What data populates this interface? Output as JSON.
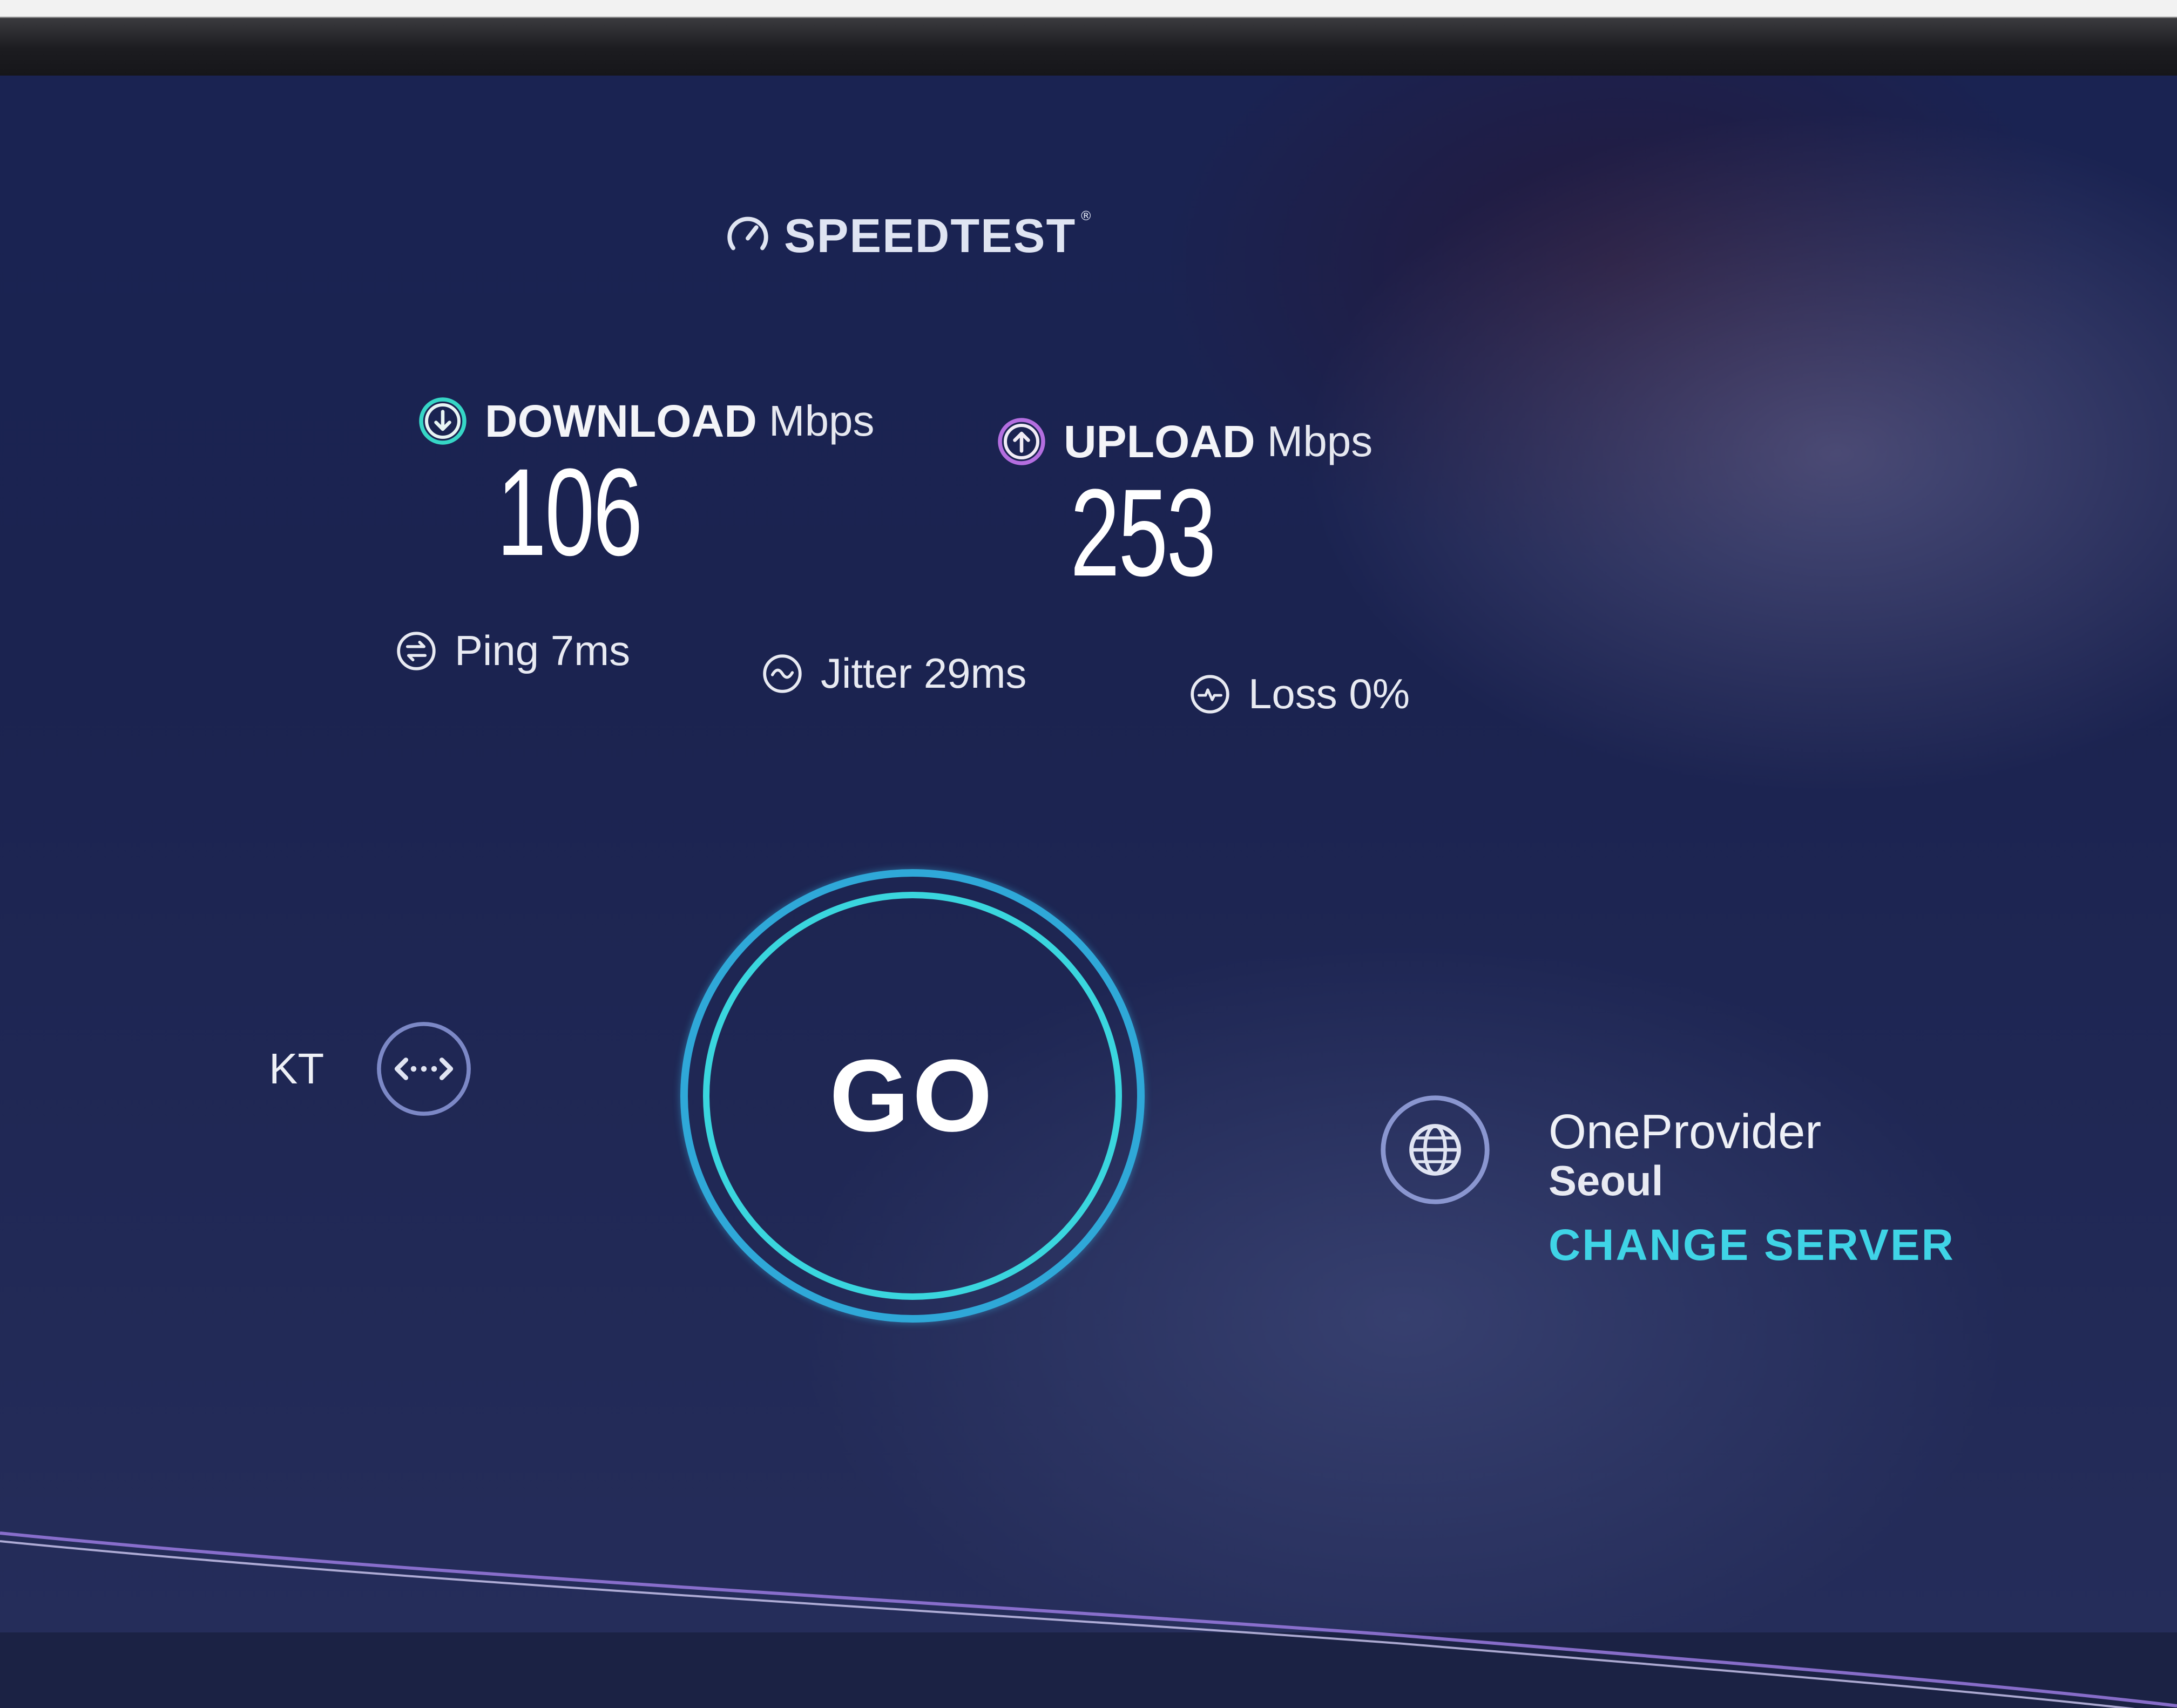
{
  "app": {
    "brand": "SPEEDTEST",
    "trademark": "®"
  },
  "results": {
    "download": {
      "label": "DOWNLOAD",
      "unit": "Mbps",
      "value": "106"
    },
    "upload": {
      "label": "UPLOAD",
      "unit": "Mbps",
      "value": "253"
    }
  },
  "stats": {
    "ping": "Ping 7ms",
    "jitter": "Jitter 29ms",
    "loss": "Loss 0%"
  },
  "isp": {
    "name": "KT"
  },
  "go_button": {
    "label": "GO"
  },
  "server": {
    "provider": "OneProvider",
    "city": "Seoul",
    "change_label": "CHANGE SERVER"
  },
  "colors": {
    "background": "#1b2350",
    "accent_cyan": "#3fd4e6",
    "ring_blue": "#2fa8d8",
    "text": "#eef0f6"
  },
  "icons": {
    "brand": "speedometer-icon",
    "download": "arrow-down-circle-icon",
    "upload": "arrow-up-circle-icon",
    "ping": "ping-arrows-icon",
    "jitter": "wave-icon",
    "loss": "pulse-icon",
    "isp": "connection-dots-icon",
    "server": "globe-icon"
  }
}
